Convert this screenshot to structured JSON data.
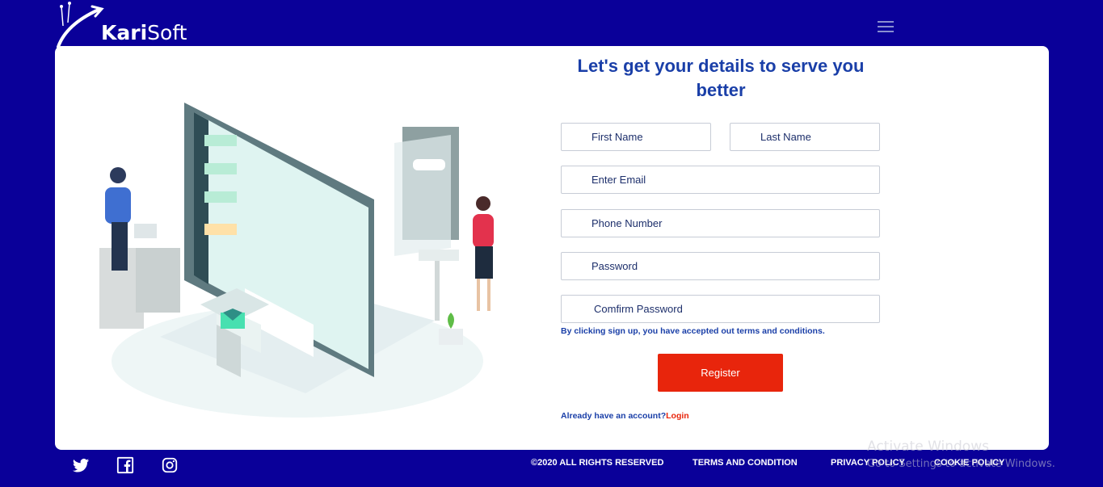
{
  "brand": {
    "name_part1": "Kari",
    "name_part2": "Soft"
  },
  "form": {
    "title": "Let's get your details to serve you better",
    "first_name_placeholder": "First Name",
    "last_name_placeholder": "Last Name",
    "email_placeholder": "Enter Email",
    "phone_placeholder": "Phone Number",
    "password_placeholder": "Password",
    "confirm_password_placeholder": "Comfirm Password",
    "terms_note": "By clicking sign up, you have accepted out terms and conditions.",
    "register_label": "Register",
    "login_prompt": "Already have an account?",
    "login_link": "Login"
  },
  "footer": {
    "copyright": "©2020 ALL RIGHTS RESERVED",
    "terms": "TERMS AND CONDITION",
    "privacy": "PRIVACY POLICY",
    "cookie": "COOKIE POLICY",
    "social_icons": [
      "twitter-icon",
      "facebook-icon",
      "instagram-icon"
    ]
  },
  "os_watermark": {
    "line1": "Activate Windows",
    "line2": "Go to Settings to activate Windows."
  },
  "colors": {
    "background": "#0a0099",
    "title": "#1a3fa8",
    "accent": "#e8250c",
    "card": "#ffffff"
  }
}
